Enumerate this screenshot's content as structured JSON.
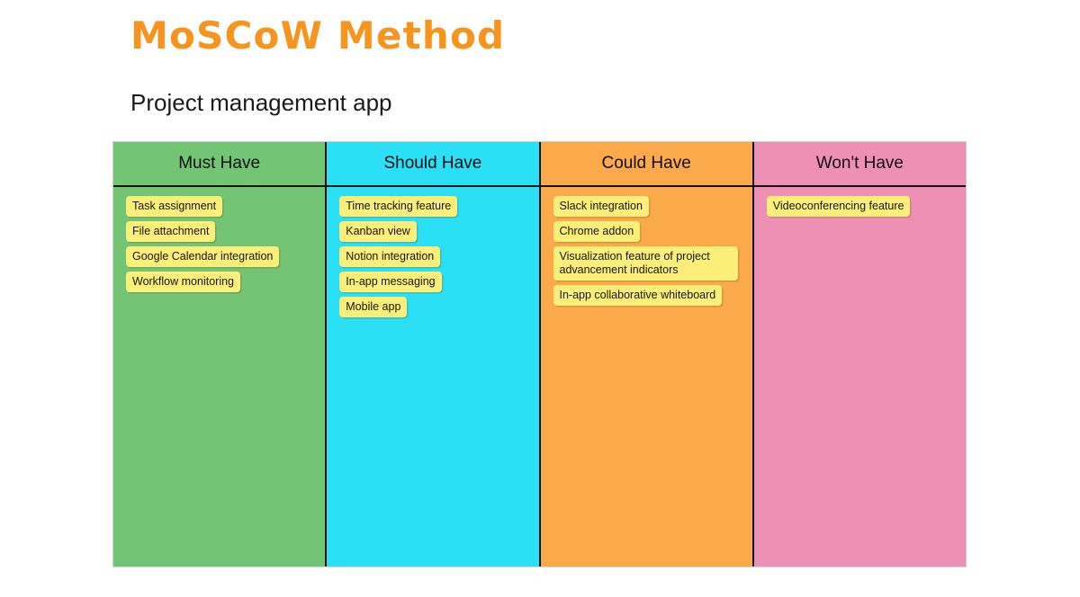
{
  "header": {
    "title": "MoSCoW Method",
    "subtitle": "Project management app"
  },
  "colors": {
    "title_orange": "#f7941e",
    "must_have": "#74c476",
    "should_have": "#2be0f5",
    "could_have": "#faa94b",
    "wont_have": "#ee8fb4",
    "note_yellow": "#fbee79",
    "grid_line": "#111111"
  },
  "board": {
    "columns": [
      {
        "label": "Must Have",
        "color": "#74c476",
        "notes": [
          {
            "text": "Task assignment",
            "wide": false
          },
          {
            "text": "File attachment",
            "wide": false
          },
          {
            "text": "Google Calendar integration",
            "wide": false
          },
          {
            "text": "Workflow monitoring",
            "wide": false
          }
        ]
      },
      {
        "label": "Should Have",
        "color": "#2be0f5",
        "notes": [
          {
            "text": "Time tracking feature",
            "wide": false
          },
          {
            "text": "Kanban view",
            "wide": false
          },
          {
            "text": "Notion integration",
            "wide": false
          },
          {
            "text": "In-app messaging",
            "wide": false
          },
          {
            "text": "Mobile app",
            "wide": false
          }
        ]
      },
      {
        "label": "Could Have",
        "color": "#faa94b",
        "notes": [
          {
            "text": "Slack integration",
            "wide": false
          },
          {
            "text": "Chrome addon",
            "wide": false
          },
          {
            "text": "Visualization feature of project advancement indicators",
            "wide": true
          },
          {
            "text": "In-app collaborative whiteboard",
            "wide": false
          }
        ]
      },
      {
        "label": "Won't Have",
        "color": "#ee8fb4",
        "notes": [
          {
            "text": "Videoconferencing feature",
            "wide": false
          }
        ]
      }
    ]
  }
}
